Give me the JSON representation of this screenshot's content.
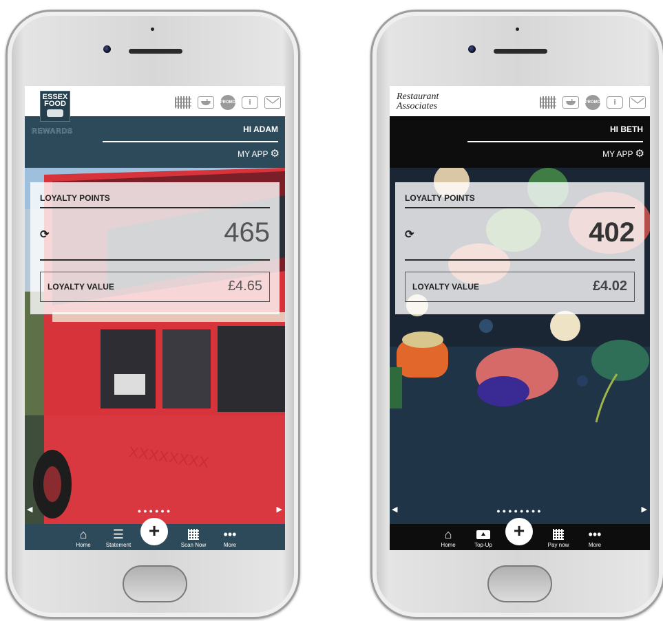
{
  "phone1": {
    "brand": {
      "logo_line1": "ESSEX",
      "logo_line2": "FOOD",
      "logo_sub": "REWARDS"
    },
    "header_icons": [
      "qr-code-icon",
      "bowl-icon",
      "promo-icon",
      "info-icon",
      "mail-icon"
    ],
    "promo_label": "PROMO",
    "info_label": "i",
    "greeting": "HI ADAM",
    "myapp_label": "MY APP",
    "card": {
      "points_label": "LOYALTY POINTS",
      "points": "465",
      "value_label": "LOYALTY VALUE",
      "value": "£4.65"
    },
    "carousel": {
      "dots": "●●●●●●",
      "prev": "◀",
      "next": "▶"
    },
    "nav": [
      {
        "label": "Home",
        "icon": "home-icon"
      },
      {
        "label": "Statement",
        "icon": "list-icon"
      },
      {
        "label": "Scan Now",
        "icon": "qr-code-icon"
      },
      {
        "label": "More",
        "icon": "more-icon"
      }
    ],
    "plus_label": "+",
    "colors": {
      "accent": "#2c4a59"
    }
  },
  "phone2": {
    "brand": {
      "logo_line1": "Restaurant",
      "logo_line2": "Associates"
    },
    "header_icons": [
      "qr-code-icon",
      "bowl-icon",
      "promo-icon",
      "info-icon",
      "mail-icon"
    ],
    "promo_label": "PROMO",
    "info_label": "i",
    "greeting": "HI BETH",
    "myapp_label": "MY APP",
    "card": {
      "points_label": "LOYALTY POINTS",
      "points": "402",
      "value_label": "LOYALTY VALUE",
      "value": "£4.02"
    },
    "carousel": {
      "dots": "●●●●●●●●",
      "prev": "◀",
      "next": "▶"
    },
    "nav": [
      {
        "label": "Home",
        "icon": "home-icon"
      },
      {
        "label": "Top-Up",
        "icon": "wallet-icon"
      },
      {
        "label": "Pay now",
        "icon": "qr-code-icon"
      },
      {
        "label": "More",
        "icon": "more-icon"
      }
    ],
    "plus_label": "+",
    "colors": {
      "accent": "#0d0d0d"
    }
  }
}
